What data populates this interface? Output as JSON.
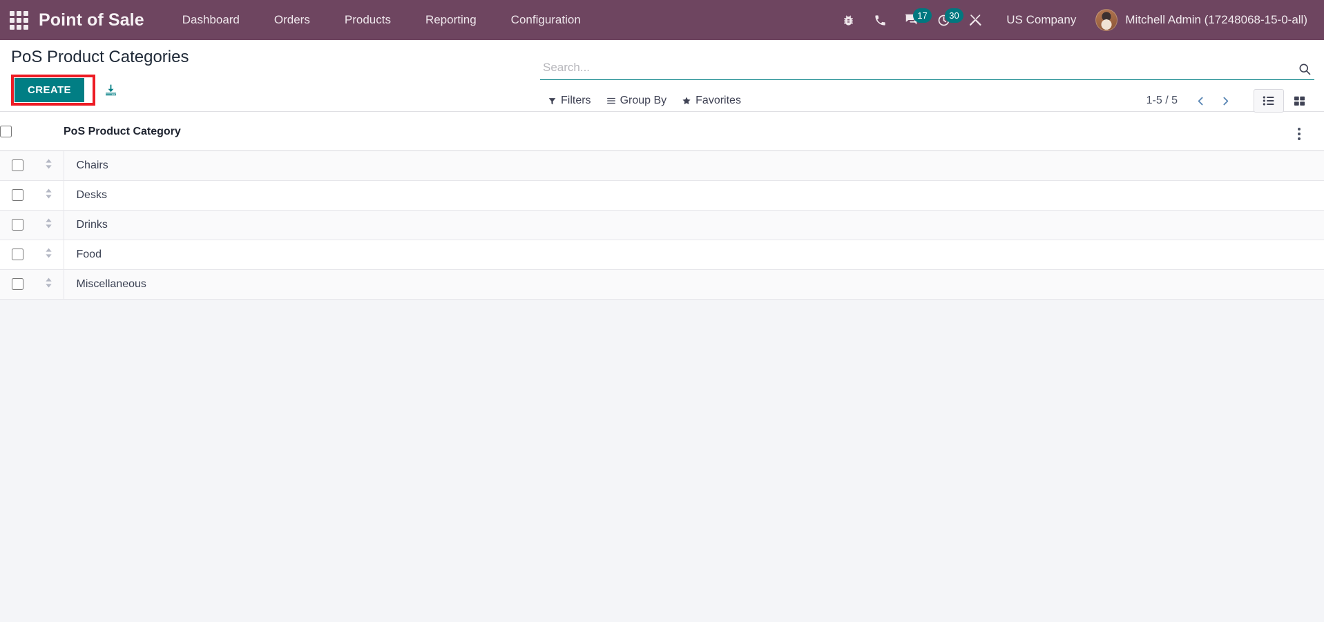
{
  "navbar": {
    "apps_icon": "apps-grid-icon",
    "brand": "Point of Sale",
    "menu_items": [
      {
        "label": "Dashboard"
      },
      {
        "label": "Orders"
      },
      {
        "label": "Products"
      },
      {
        "label": "Reporting"
      },
      {
        "label": "Configuration"
      }
    ],
    "system_icons": [
      {
        "name": "bug-icon",
        "badge": null
      },
      {
        "name": "phone-icon",
        "badge": null
      },
      {
        "name": "messages-icon",
        "badge": "17"
      },
      {
        "name": "activities-clock-icon",
        "badge": "30"
      },
      {
        "name": "tools-icon",
        "badge": null
      }
    ],
    "company": "US Company",
    "user": "Mitchell Admin (17248068-15-0-all)",
    "background_color": "#6E4560",
    "badge_color": "#01777F"
  },
  "control_panel": {
    "title": "PoS Product Categories",
    "create_label": "CREATE",
    "create_color": "#017E84",
    "highlight_color": "#ED1C24",
    "import_icon": "import-download-icon",
    "search": {
      "placeholder": "Search...",
      "value": "",
      "underline_color": "#017E84",
      "search_icon": "search-magnifier-icon"
    },
    "filter_buttons": [
      {
        "label": "Filters",
        "icon": "filter-funnel-icon"
      },
      {
        "label": "Group By",
        "icon": "group-by-lines-icon"
      },
      {
        "label": "Favorites",
        "icon": "favorites-star-icon"
      }
    ],
    "pager": {
      "range": "1-5 / 5",
      "previous_icon": "chevron-left-icon",
      "next_icon": "chevron-right-icon"
    },
    "views": [
      {
        "name": "list-view",
        "icon": "list-view-icon",
        "active": true
      },
      {
        "name": "kanban-view",
        "icon": "kanban-view-icon",
        "active": false
      }
    ]
  },
  "list": {
    "columns": [
      {
        "key": "name",
        "label": "PoS Product Category"
      }
    ],
    "select_all_name": "select-all-checkbox",
    "options_icon": "optional-columns-dots-icon",
    "rows": [
      {
        "name": "Chairs"
      },
      {
        "name": "Desks"
      },
      {
        "name": "Drinks"
      },
      {
        "name": "Food"
      },
      {
        "name": "Miscellaneous"
      }
    ]
  }
}
